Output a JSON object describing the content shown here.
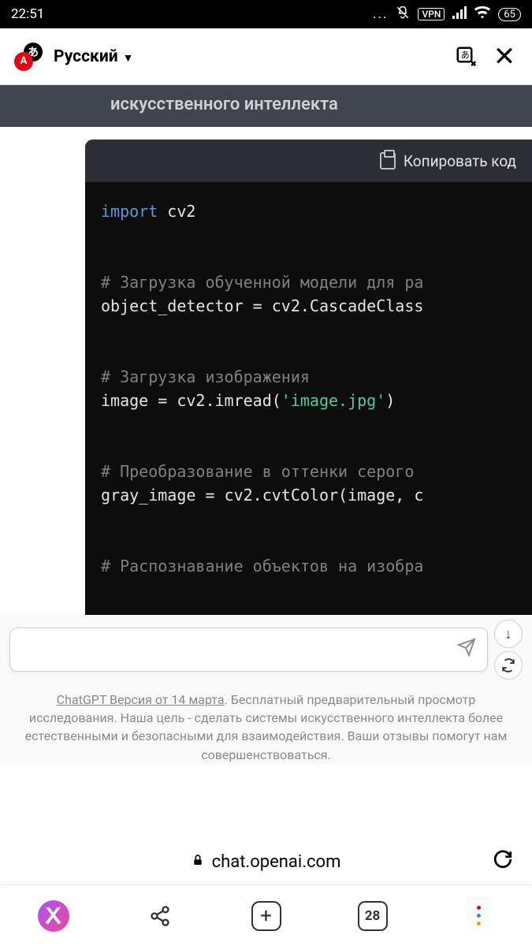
{
  "status": {
    "time": "22:51",
    "vpn": "VPN",
    "battery": "65"
  },
  "translate_bar": {
    "language": "Русский"
  },
  "partial_heading": "искусственного интеллекта",
  "code": {
    "copy_label": "Копировать код",
    "line1_kw": "import",
    "line1_rest": " cv2",
    "line2": "# Загрузка обученной модели для ра",
    "line3": "object_detector = cv2.CascadeClass",
    "line4": "# Загрузка изображения",
    "line5a": "image = cv2.imread(",
    "line5b": "'image.jpg'",
    "line5c": ")",
    "line6": "# Преобразование в оттенки серого",
    "line7": "gray_image = cv2.cvtColor(image, c",
    "line8": "# Распознавание объектов на изобра"
  },
  "footer": {
    "link": "ChatGPT Версия от 14 марта",
    "text": ". Бесплатный предварительный просмотр исследования. Наша цель - сделать системы искусственного интеллекта более естественными и безопасными для взаимодействия. Ваши отзывы помогут нам совершенствоваться."
  },
  "url": "chat.openai.com",
  "nav": {
    "tabs_count": "28"
  }
}
